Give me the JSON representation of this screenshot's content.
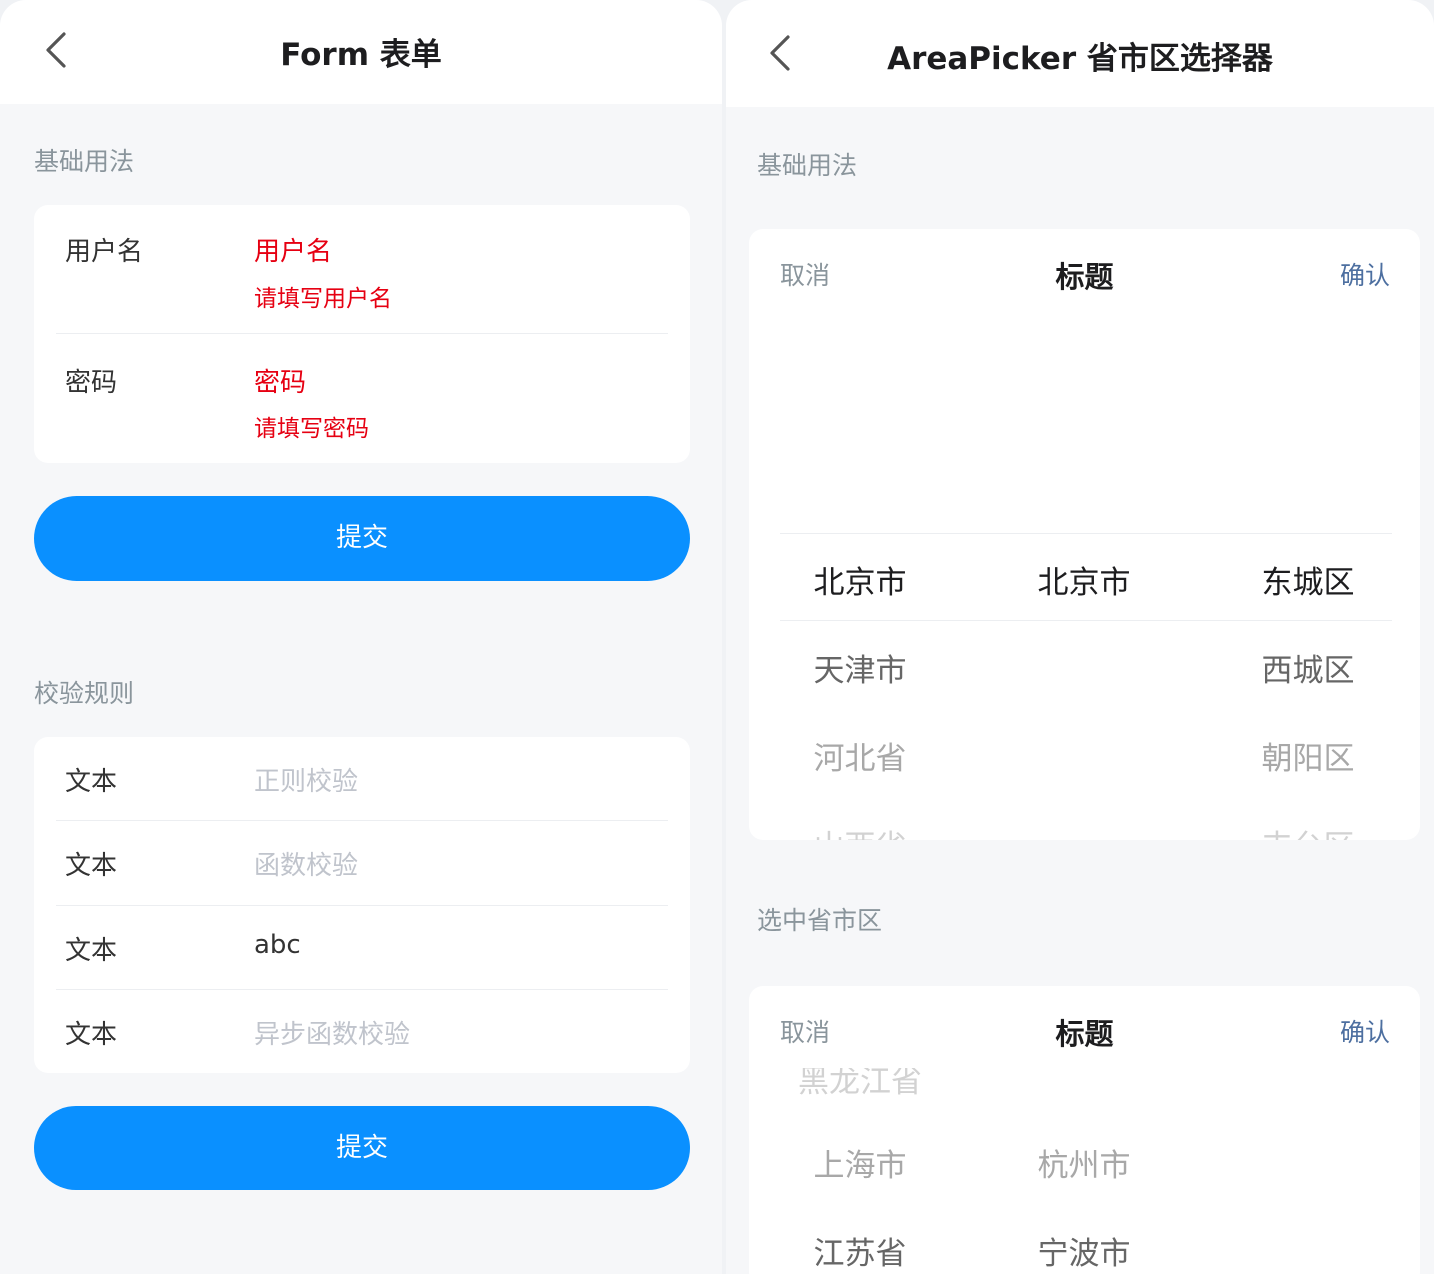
{
  "form_page": {
    "title": "Form 表单",
    "section_basic": "基础用法",
    "username": {
      "label": "用户名",
      "value": "用户名",
      "error": "请填写用户名"
    },
    "password": {
      "label": "密码",
      "value": "密码",
      "error": "请填写密码"
    },
    "submit_label": "提交",
    "section_rules": "校验规则",
    "rules_rows": [
      {
        "label": "文本",
        "text": "正则校验"
      },
      {
        "label": "文本",
        "text": "函数校验"
      },
      {
        "label": "文本",
        "text": "abc"
      },
      {
        "label": "文本",
        "text": "异步函数校验"
      }
    ],
    "submit_label_2": "提交"
  },
  "area_page": {
    "title": "AreaPicker 省市区选择器",
    "section_basic": "基础用法",
    "picker1": {
      "cancel": "取消",
      "title": "标题",
      "confirm": "确认",
      "provinces": [
        "北京市",
        "天津市",
        "河北省",
        "山西省"
      ],
      "cities": [
        "北京市"
      ],
      "districts": [
        "东城区",
        "西城区",
        "朝阳区",
        "丰台区"
      ]
    },
    "section_selected": "选中省市区",
    "picker2": {
      "cancel": "取消",
      "title": "标题",
      "confirm": "确认",
      "provinces": [
        "黑龙江省",
        "上海市",
        "江苏省"
      ],
      "cities": [
        "杭州市",
        "宁波市"
      ]
    }
  },
  "icons": {
    "back": "chevron-left-icon"
  }
}
